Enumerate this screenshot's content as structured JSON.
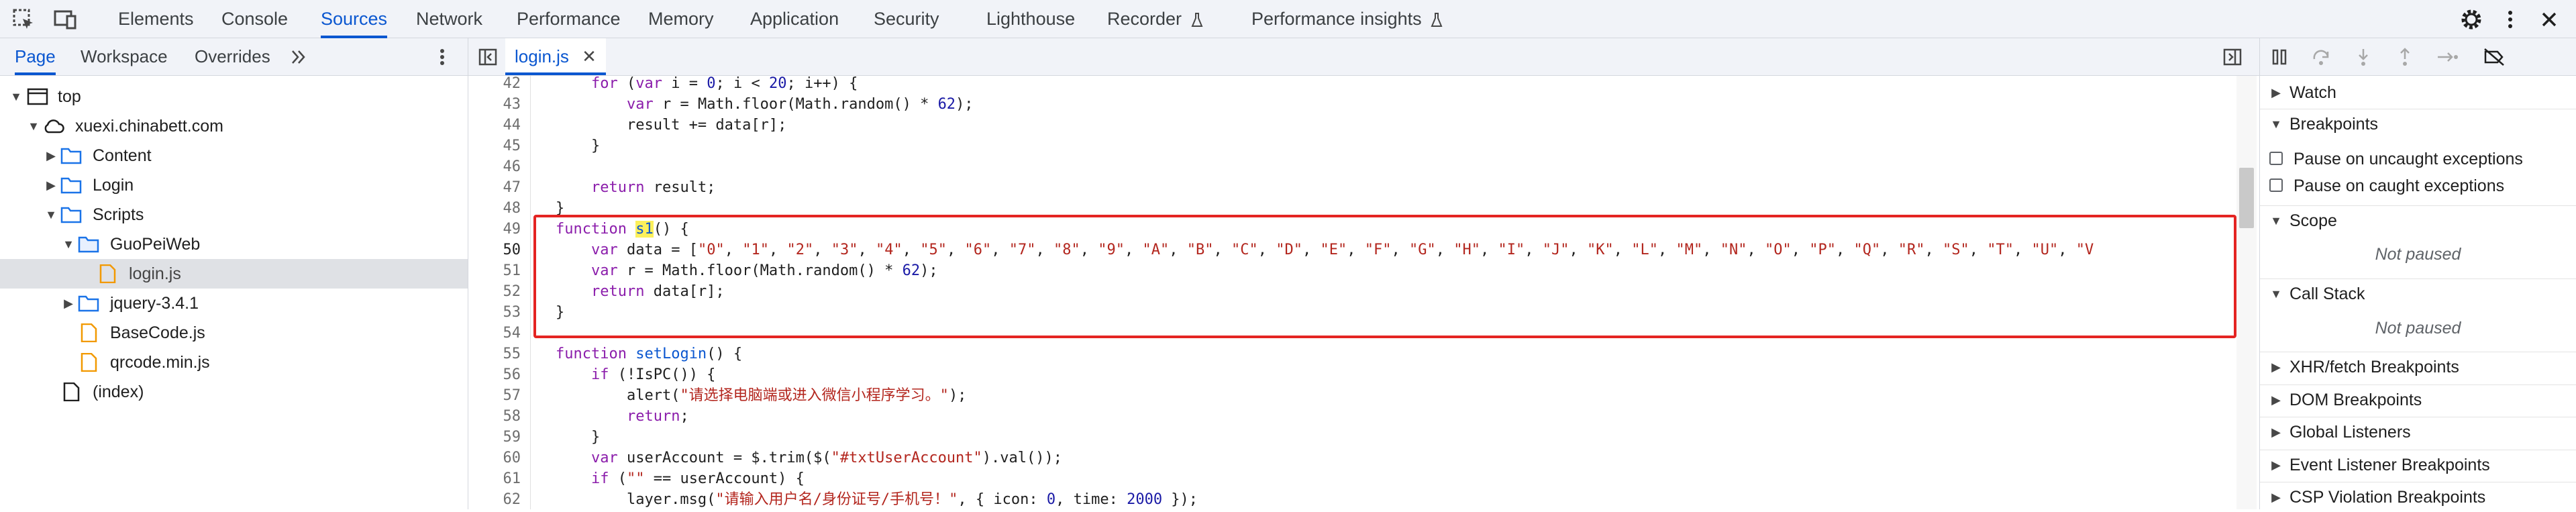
{
  "devtools": {
    "top_tabs": [
      "Elements",
      "Console",
      "Sources",
      "Network",
      "Performance",
      "Memory",
      "Application",
      "Security",
      "Lighthouse",
      "Recorder",
      "Performance insights"
    ],
    "active_top_tab": "Sources"
  },
  "navigator": {
    "tabs": [
      "Page",
      "Workspace",
      "Overrides"
    ],
    "active_tab": "Page"
  },
  "tree": [
    {
      "label": "top"
    },
    {
      "label": "xuexi.chinabett.com"
    },
    {
      "label": "Content"
    },
    {
      "label": "Login"
    },
    {
      "label": "Scripts"
    },
    {
      "label": "GuoPeiWeb"
    },
    {
      "label": "login.js"
    },
    {
      "label": "jquery-3.4.1"
    },
    {
      "label": "BaseCode.js"
    },
    {
      "label": "qrcode.min.js"
    },
    {
      "label": "(index)"
    }
  ],
  "editor": {
    "open_file": "login.js",
    "lines": [
      {
        "n": "42",
        "text": "    for (var i = 0; i < 20; i++) {"
      },
      {
        "n": "43",
        "text": "        var r = Math.floor(Math.random() * 62);"
      },
      {
        "n": "44",
        "text": "        result += data[r];"
      },
      {
        "n": "45",
        "text": "    }"
      },
      {
        "n": "46",
        "text": ""
      },
      {
        "n": "47",
        "text": "    return result;"
      },
      {
        "n": "48",
        "text": "}"
      },
      {
        "n": "49",
        "text": "function s1() {"
      },
      {
        "n": "50",
        "text": "    var data = [\"0\", \"1\", \"2\", \"3\", \"4\", \"5\", \"6\", \"7\", \"8\", \"9\", \"A\", \"B\", \"C\", \"D\", \"E\", \"F\", \"G\", \"H\", \"I\", \"J\", \"K\", \"L\", \"M\", \"N\", \"O\", \"P\", \"Q\", \"R\", \"S\", \"T\", \"U\", \"V"
      },
      {
        "n": "51",
        "text": "    var r = Math.floor(Math.random() * 62);"
      },
      {
        "n": "52",
        "text": "    return data[r];"
      },
      {
        "n": "53",
        "text": "}"
      },
      {
        "n": "54",
        "text": ""
      },
      {
        "n": "55",
        "text": "function setLogin() {"
      },
      {
        "n": "56",
        "text": "    if (!IsPC()) {"
      },
      {
        "n": "57",
        "text": "        alert(\"请选择电脑端或进入微信小程序学习。\");"
      },
      {
        "n": "58",
        "text": "        return;"
      },
      {
        "n": "59",
        "text": "    }"
      },
      {
        "n": "60",
        "text": "    var userAccount = $.trim($(\"#txtUserAccount\").val());"
      },
      {
        "n": "61",
        "text": "    if (\"\" == userAccount) {"
      },
      {
        "n": "62",
        "text": "        layer.msg(\"请输入用户名/身份证号/手机号！\", { icon: 0, time: 2000 });"
      }
    ]
  },
  "debugger": {
    "sections": {
      "watch": "Watch",
      "breakpoints": "Breakpoints",
      "pause_uncaught": "Pause on uncaught exceptions",
      "pause_caught": "Pause on caught exceptions",
      "scope": "Scope",
      "scope_status": "Not paused",
      "call_stack": "Call Stack",
      "call_stack_status": "Not paused",
      "xhr": "XHR/fetch Breakpoints",
      "dom": "DOM Breakpoints",
      "global": "Global Listeners",
      "event": "Event Listener Breakpoints",
      "csp": "CSP Violation Breakpoints"
    }
  },
  "colors": {
    "accent": "#0b57d0",
    "highlight_box": "#e42422",
    "search_highlight": "#fcf05b",
    "folder": "#1a73e8",
    "js_file": "#f29900"
  }
}
